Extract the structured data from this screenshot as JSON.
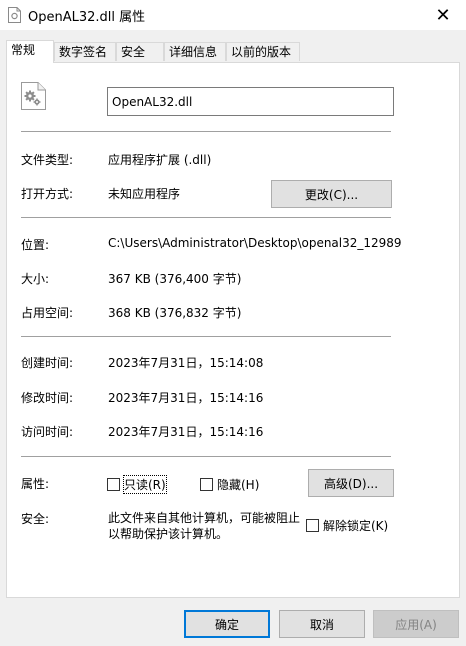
{
  "window": {
    "title": "OpenAL32.dll 属性",
    "close_glyph": "✕"
  },
  "tabs": [
    {
      "label": "常规",
      "active": true
    },
    {
      "label": "数字签名"
    },
    {
      "label": "安全"
    },
    {
      "label": "详细信息"
    },
    {
      "label": "以前的版本"
    }
  ],
  "general": {
    "filename": "OpenAL32.dll",
    "file_type_label": "文件类型:",
    "file_type_value": "应用程序扩展 (.dll)",
    "opens_with_label": "打开方式:",
    "opens_with_value": "未知应用程序",
    "change_button": "更改(C)...",
    "location_label": "位置:",
    "location_value": "C:\\Users\\Administrator\\Desktop\\openal32_12989",
    "size_label": "大小:",
    "size_value": "367 KB (376,400 字节)",
    "size_on_disk_label": "占用空间:",
    "size_on_disk_value": "368 KB (376,832 字节)",
    "created_label": "创建时间:",
    "created_value": "2023年7月31日，15:14:08",
    "modified_label": "修改时间:",
    "modified_value": "2023年7月31日，15:14:16",
    "accessed_label": "访问时间:",
    "accessed_value": "2023年7月31日，15:14:16",
    "attributes_label": "属性:",
    "readonly_label": "只读(R)",
    "hidden_label": "隐藏(H)",
    "advanced_button": "高级(D)...",
    "security_label": "安全:",
    "security_text": "此文件来自其他计算机，可能被阻止以帮助保护该计算机。",
    "unblock_label": "解除锁定(K)"
  },
  "footer": {
    "ok": "确定",
    "cancel": "取消",
    "apply": "应用(A)"
  },
  "icons": {
    "title_icon": "dll-file-icon",
    "file_icon": "gear-file-icon"
  },
  "colors": {
    "accent": "#0078d7",
    "panel_bg": "#ffffff",
    "window_bg": "#f0f0f0"
  }
}
